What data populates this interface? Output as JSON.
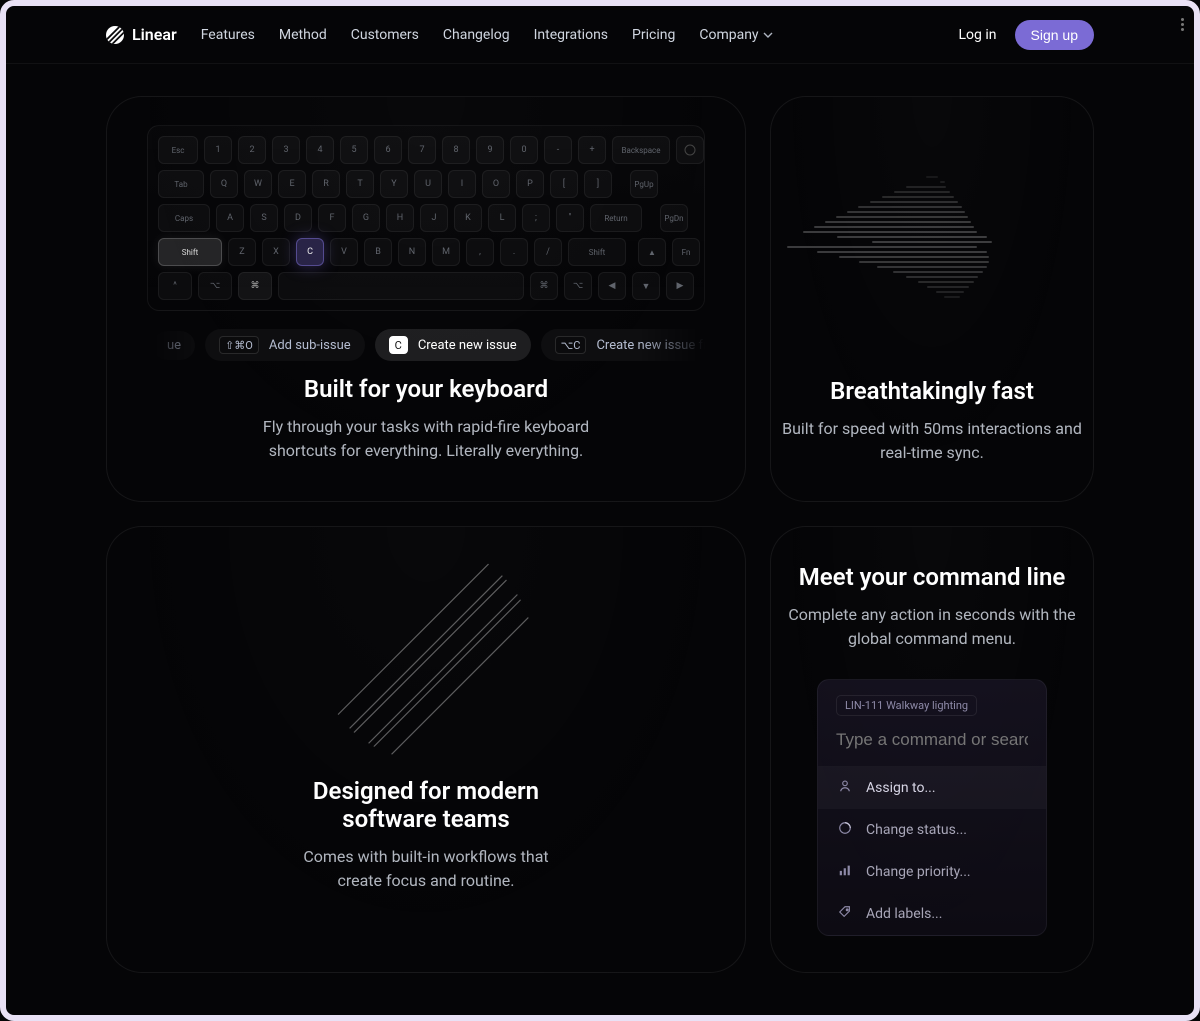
{
  "nav": {
    "brand": "Linear",
    "links": [
      "Features",
      "Method",
      "Customers",
      "Changelog",
      "Integrations",
      "Pricing",
      "Company"
    ],
    "login": "Log in",
    "signup": "Sign up"
  },
  "cardA": {
    "title": "Built for your keyboard",
    "sub": "Fly through your tasks with rapid-fire keyboard shortcuts for everything. Literally everything.",
    "kb": {
      "row1": [
        "Esc",
        "1",
        "2",
        "3",
        "4",
        "5",
        "6",
        "7",
        "8",
        "9",
        "0",
        "-",
        "+",
        "Backspace"
      ],
      "row2": [
        "Tab",
        "Q",
        "W",
        "E",
        "R",
        "T",
        "Y",
        "U",
        "I",
        "O",
        "P",
        "[",
        "]"
      ],
      "row2r": [
        "PgUp"
      ],
      "row3": [
        "Caps",
        "A",
        "S",
        "D",
        "F",
        "G",
        "H",
        "J",
        "K",
        "L",
        ";",
        "\"",
        "Return"
      ],
      "row3r": [
        "PgDn"
      ],
      "row4": [
        "Shift",
        "Z",
        "X",
        "C",
        "V",
        "B",
        "N",
        "M",
        ",",
        ".",
        "/",
        "Shift"
      ],
      "row4r": [
        "▲",
        "Fn"
      ],
      "row5l": [
        "^",
        "⌥",
        "⌘"
      ],
      "row5r": [
        "⌘",
        "⌥",
        "◀",
        "▼",
        "▶"
      ]
    },
    "shortcuts": [
      {
        "keys": "",
        "label": "ue",
        "edge": true
      },
      {
        "keys": "⇧⌘O",
        "label": "Add sub-issue"
      },
      {
        "keys": "C",
        "label": "Create new issue",
        "active": true
      },
      {
        "keys": "⌥C",
        "label": "Create new issue from te…",
        "edge": true
      }
    ]
  },
  "cardB": {
    "title": "Breathtakingly fast",
    "sub": "Built for speed with 50ms interactions and real-time sync."
  },
  "cardC": {
    "title": "Designed for modern software teams",
    "sub": "Comes with built-in workflows that create focus and routine."
  },
  "cardD": {
    "title": "Meet your command line",
    "sub": "Complete any action in seconds with the global command menu.",
    "cmd": {
      "tag": "LIN-111 Walkway lighting",
      "placeholder": "Type a command or search...",
      "items": [
        {
          "icon": "assignee",
          "label": "Assign to...",
          "selected": true
        },
        {
          "icon": "status",
          "label": "Change status..."
        },
        {
          "icon": "priority",
          "label": "Change priority..."
        },
        {
          "icon": "label",
          "label": "Add labels..."
        }
      ]
    }
  }
}
